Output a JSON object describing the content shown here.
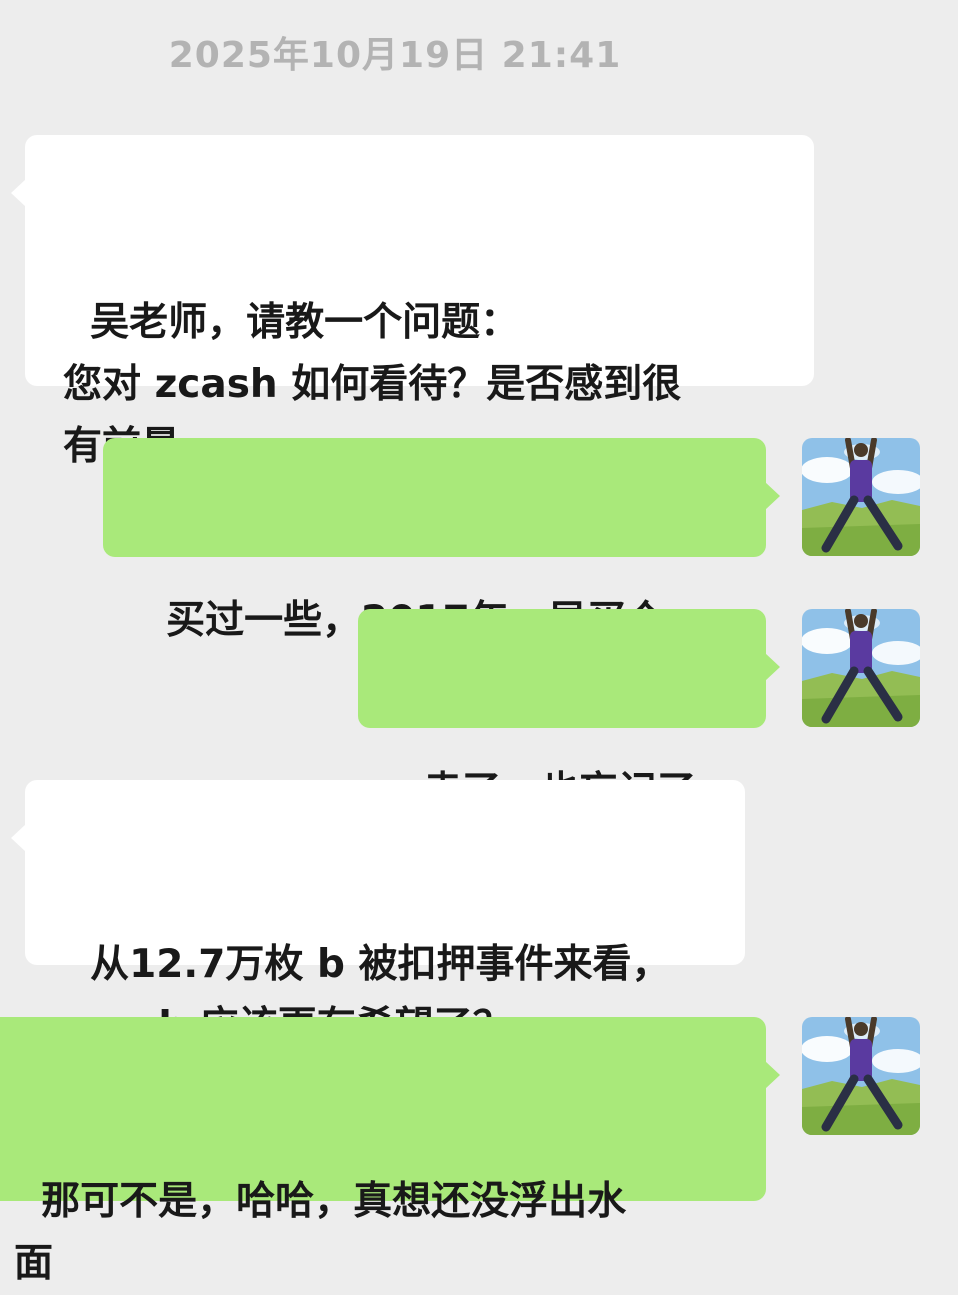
{
  "chat": {
    "timestamp": "2025年10月19日 21:41",
    "messages": [
      {
        "sender": "other",
        "text": "吴老师，请教一个问题：\n您对 zcash 如何看待？是否感到很\n有前景…"
      },
      {
        "sender": "self",
        "text": "买过一些，2017年，早买个"
      },
      {
        "sender": "self",
        "text": "卖了，也忘记了"
      },
      {
        "sender": "other",
        "text": "从12.7万枚 b 被扣押事件来看，\nzcash 应该更有希望了？"
      },
      {
        "sender": "self",
        "text": "那可不是，哈哈，真想还没浮出水\n面"
      }
    ]
  },
  "colors": {
    "background": "#ededed",
    "incoming_bubble": "#ffffff",
    "outgoing_bubble": "#a9e97a",
    "timestamp_text": "#b3b3b3"
  },
  "avatar_icon": "user-avatar-photo"
}
